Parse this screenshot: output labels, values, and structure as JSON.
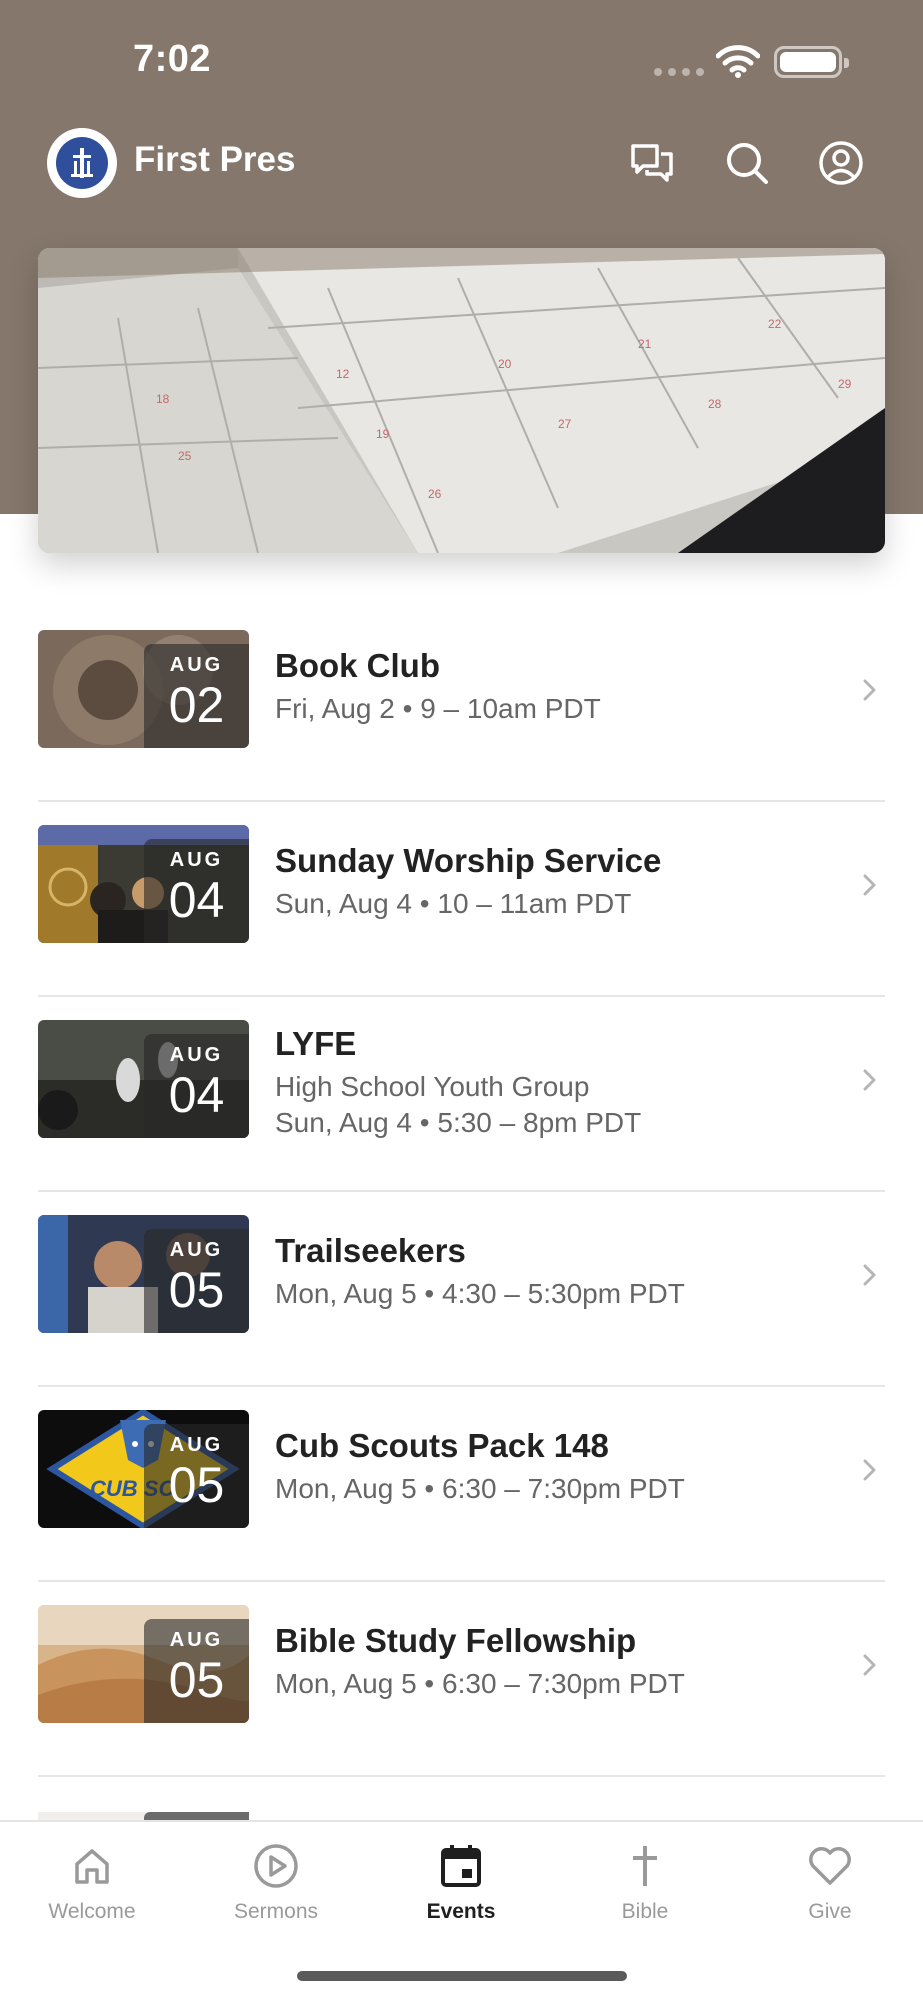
{
  "status_bar": {
    "time": "7:02"
  },
  "app_bar": {
    "title": "First Pres"
  },
  "colors": {
    "header": "#85776b",
    "accent_text": "#1f1f1f",
    "muted": "#9a9a9a"
  },
  "events": [
    {
      "month": "AUG",
      "day": "02",
      "title": "Book Club",
      "subtitle": "",
      "when": "Fri, Aug 2 • 9 – 10am PDT"
    },
    {
      "month": "AUG",
      "day": "04",
      "title": "Sunday Worship Service",
      "subtitle": "",
      "when": "Sun, Aug 4 • 10 – 11am PDT"
    },
    {
      "month": "AUG",
      "day": "04",
      "title": "LYFE",
      "subtitle": "High School Youth Group",
      "when": "Sun, Aug 4 • 5:30 – 8pm PDT"
    },
    {
      "month": "AUG",
      "day": "05",
      "title": "Trailseekers",
      "subtitle": "",
      "when": "Mon, Aug 5 • 4:30 – 5:30pm PDT"
    },
    {
      "month": "AUG",
      "day": "05",
      "title": "Cub Scouts Pack 148",
      "subtitle": "",
      "when": "Mon, Aug 5 • 6:30 – 7:30pm PDT"
    },
    {
      "month": "AUG",
      "day": "05",
      "title": "Bible Study Fellowship",
      "subtitle": "",
      "when": "Mon, Aug 5 • 6:30 – 7:30pm PDT"
    }
  ],
  "tabs": [
    {
      "label": "Welcome",
      "icon": "home-icon"
    },
    {
      "label": "Sermons",
      "icon": "play-icon"
    },
    {
      "label": "Events",
      "icon": "calendar-icon",
      "active": true
    },
    {
      "label": "Bible",
      "icon": "cross-icon"
    },
    {
      "label": "Give",
      "icon": "heart-icon"
    }
  ]
}
